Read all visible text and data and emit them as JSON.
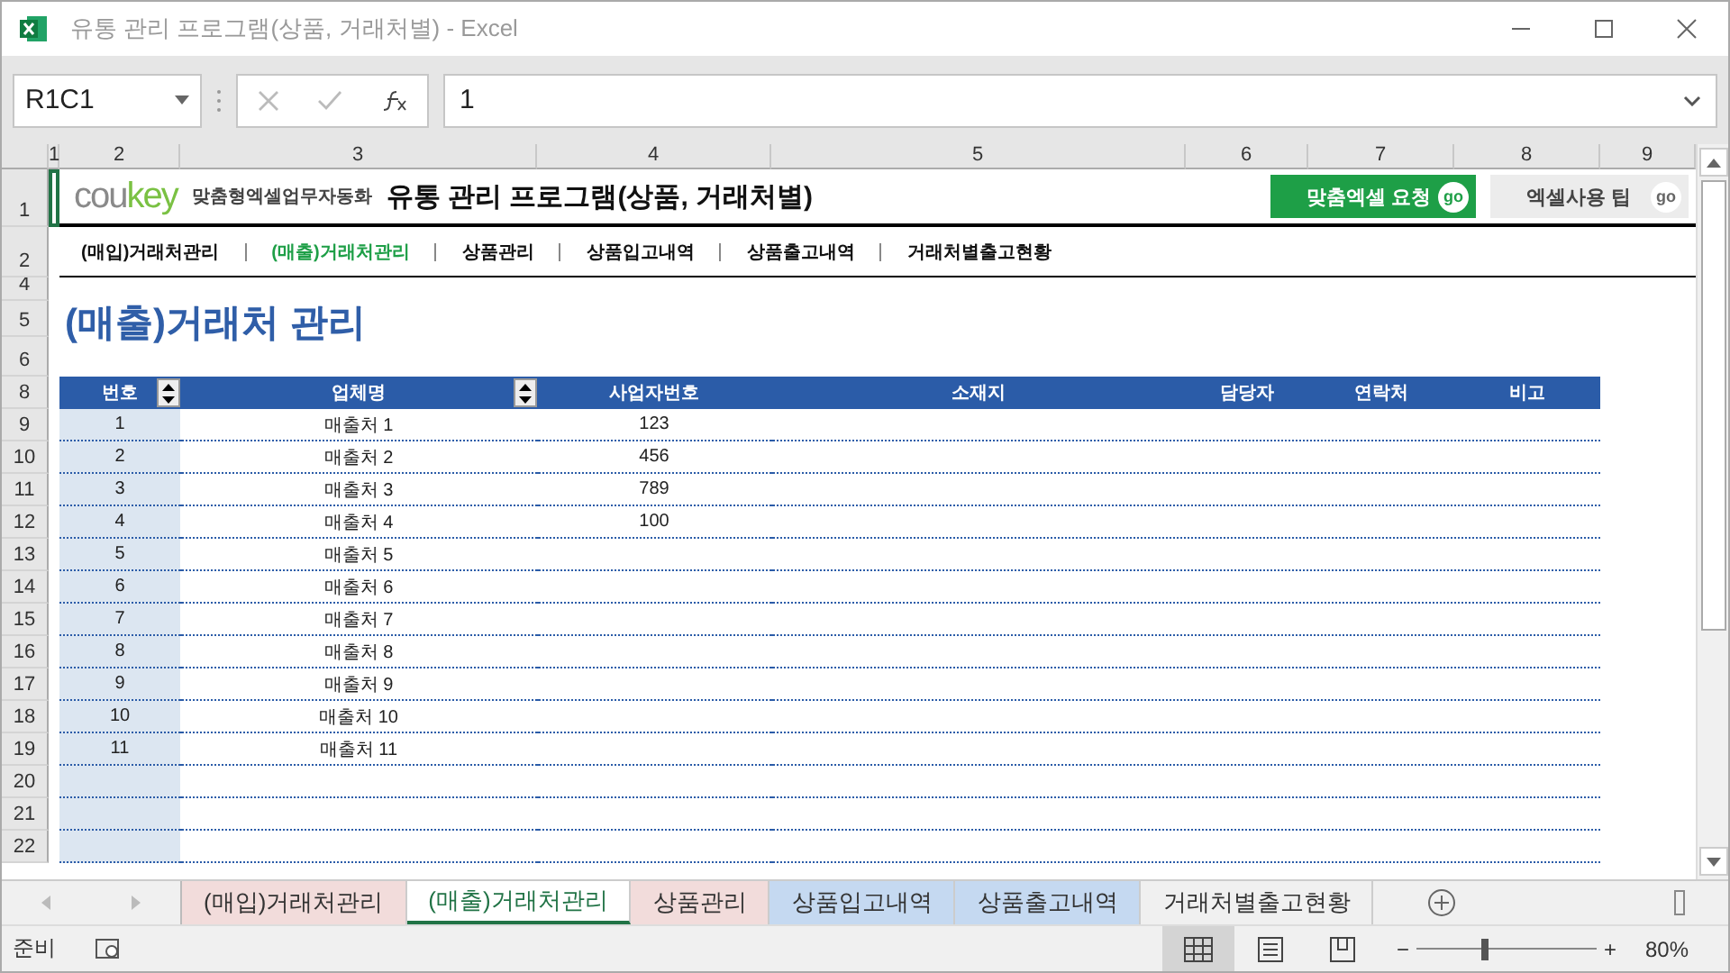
{
  "window": {
    "title": "유통 관리 프로그램(상품, 거래처별) - Excel"
  },
  "formula_bar": {
    "name_box": "R1C1",
    "formula": "1"
  },
  "column_headers": [
    "1",
    "2",
    "3",
    "4",
    "5",
    "6",
    "7",
    "8",
    "9"
  ],
  "row_headers": [
    "1",
    "2",
    "4",
    "5",
    "6",
    "8",
    "9",
    "10",
    "11",
    "12",
    "13",
    "14",
    "15",
    "16",
    "17",
    "18",
    "19",
    "20",
    "21",
    "22"
  ],
  "header": {
    "logo_gray": "cou",
    "logo_green": "key",
    "tagline": "맞춤형엑셀업무자동화",
    "title": "유통 관리 프로그램(상품, 거래처별)",
    "buttons": [
      {
        "label": "맞춤엑셀 요청",
        "go": "go",
        "kind": "primary"
      },
      {
        "label": "엑셀사용 팁",
        "go": "go",
        "kind": "secondary"
      }
    ]
  },
  "nav": [
    {
      "label": "(매입)거래처관리",
      "selected": false
    },
    {
      "label": "(매출)거래처관리",
      "selected": true
    },
    {
      "label": "상품관리",
      "selected": false
    },
    {
      "label": "상품입고내역",
      "selected": false
    },
    {
      "label": "상품출고내역",
      "selected": false
    },
    {
      "label": "거래처별출고현황",
      "selected": false
    }
  ],
  "page_title": "(매출)거래처 관리",
  "table": {
    "columns": [
      {
        "label": "번호",
        "sortable": true
      },
      {
        "label": "업체명",
        "sortable": true
      },
      {
        "label": "사업자번호",
        "sortable": false
      },
      {
        "label": "소재지",
        "sortable": false
      },
      {
        "label": "담당자",
        "sortable": false
      },
      {
        "label": "연락처",
        "sortable": false
      },
      {
        "label": "비고",
        "sortable": false
      }
    ],
    "rows": [
      {
        "number": "1",
        "name": "매출처 1",
        "business_no": "123"
      },
      {
        "number": "2",
        "name": "매출처 2",
        "business_no": "456"
      },
      {
        "number": "3",
        "name": "매출처 3",
        "business_no": "789"
      },
      {
        "number": "4",
        "name": "매출처 4",
        "business_no": "100"
      },
      {
        "number": "5",
        "name": "매출처 5"
      },
      {
        "number": "6",
        "name": "매출처 6"
      },
      {
        "number": "7",
        "name": "매출처 7"
      },
      {
        "number": "8",
        "name": "매출처 8"
      },
      {
        "number": "9",
        "name": "매출처 9"
      },
      {
        "number": "10",
        "name": "매출처 10"
      },
      {
        "number": "11",
        "name": "매출처 11"
      }
    ]
  },
  "sheet_tabs": [
    {
      "label": "(매입)거래처관리",
      "selected": false,
      "color": "#f2dcdb"
    },
    {
      "label": "(매출)거래처관리",
      "selected": true
    },
    {
      "label": "상품관리",
      "selected": false,
      "color": "#f2dcdb"
    },
    {
      "label": "상품입고내역",
      "selected": false,
      "color": "#c5d9f1"
    },
    {
      "label": "상품출고내역",
      "selected": false,
      "color": "#c5d9f1"
    },
    {
      "label": "거래처별출고현황",
      "selected": false
    }
  ],
  "status_bar": {
    "status": "준비",
    "zoom": {
      "minus": "−",
      "plus": "+",
      "level": 0.38,
      "reading": "80%"
    }
  }
}
